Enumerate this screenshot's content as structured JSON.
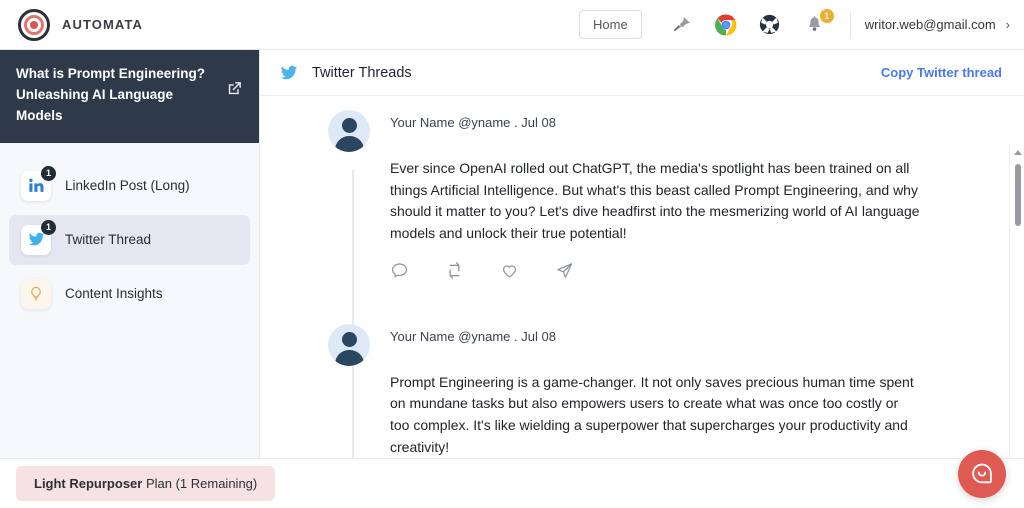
{
  "topbar": {
    "brand_name": "AUTOMATA",
    "logo_icon": "bullseye-target-icon",
    "home_label": "Home",
    "pin_icon": "pushpin-icon",
    "chrome_icon": "chrome-extension-icon",
    "support_icon": "life-ring-support-icon",
    "bell_icon": "notification-bell-icon",
    "bell_badge": "1",
    "email": "writor.web@gmail.com",
    "chevron": "›",
    "accent_badge_color": "#f0ad2e"
  },
  "sidebar": {
    "doc_title": "What is Prompt Engineering? Unleashing AI Language Models",
    "external_link_icon": "external-link-icon",
    "header_bg": "#2e3a4a",
    "items": [
      {
        "label": "LinkedIn Post (Long)",
        "icon": "linkedin-icon",
        "badge": "1",
        "active": false
      },
      {
        "label": "Twitter Thread",
        "icon": "twitter-icon",
        "badge": "1",
        "active": true
      },
      {
        "label": "Content Insights",
        "icon": "lightbulb-icon",
        "badge": "",
        "active": false
      }
    ]
  },
  "main": {
    "title": "Twitter Threads",
    "title_icon": "twitter-bird-icon",
    "copy_label": "Copy Twitter thread",
    "copy_color": "#4a78f0",
    "tweets": [
      {
        "author": "Your Name",
        "handle": "@yname",
        "separator": ".",
        "date": "Jul 08",
        "text": "Ever since OpenAI rolled out ChatGPT, the media's spotlight has been trained on all things Artificial Intelligence. But what's this beast called Prompt Engineering, and why should it matter to you? Let's dive headfirst into the mesmerizing world of AI language models and unlock their true potential!",
        "actions": [
          "reply-icon",
          "retweet-icon",
          "like-heart-icon",
          "share-icon"
        ]
      },
      {
        "author": "Your Name",
        "handle": "@yname",
        "separator": ".",
        "date": "Jul 08",
        "text": "Prompt Engineering is a game-changer. It not only saves precious human time spent on mundane tasks but also empowers users to create what was once too costly or too complex. It's like wielding a superpower that supercharges your productivity and creativity!",
        "actions": [
          "reply-icon",
          "retweet-icon",
          "like-heart-icon",
          "share-icon"
        ]
      }
    ]
  },
  "plan": {
    "name": "Light Repurposer",
    "suffix": " Plan (1 Remaining)",
    "bg_color": "#f6e2e2"
  },
  "chat_widget": {
    "icon": "chat-smiley-bubble-icon",
    "color": "#e05a54"
  },
  "scrollbar": {
    "up_arrow_icon": "scroll-up-arrow-icon",
    "thumb_icon": "scrollbar-thumb"
  }
}
